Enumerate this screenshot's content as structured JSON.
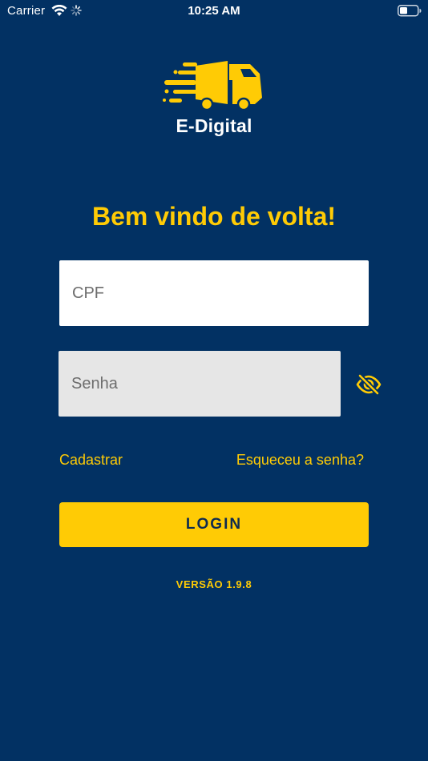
{
  "status_bar": {
    "carrier": "Carrier",
    "time": "10:25 AM",
    "icons": [
      "wifi-icon",
      "activity-spinner-icon",
      "battery-icon"
    ]
  },
  "logo": {
    "text": "E-Digital",
    "icon": "speeding-truck-icon",
    "colors": {
      "truck": "#ffcb05",
      "text": "#ffffff"
    }
  },
  "welcome": {
    "title": "Bem vindo de volta!"
  },
  "form": {
    "cpf": {
      "placeholder": "CPF",
      "value": ""
    },
    "password": {
      "placeholder": "Senha",
      "value": "",
      "toggle_icon": "eye-slash-icon"
    },
    "register_label": "Cadastrar",
    "forgot_label": "Esqueceu a senha?",
    "login_label": "LOGIN"
  },
  "version": "VERSÃO 1.9.8",
  "colors": {
    "background": "#023163",
    "accent": "#ffcb05",
    "input_bg": "#ffffff",
    "input_bg_secondary": "#e6e6e6",
    "button_text": "#0f2b50"
  }
}
